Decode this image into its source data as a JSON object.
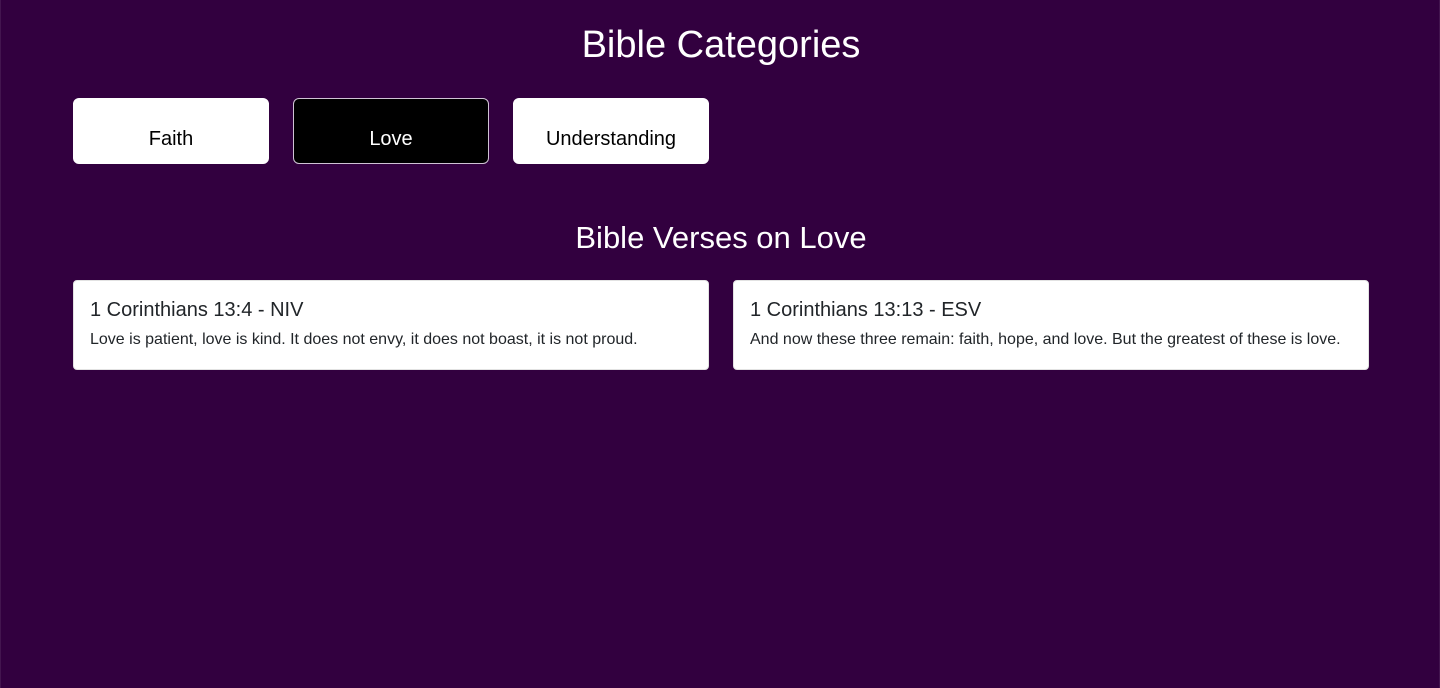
{
  "header": {
    "title": "Bible Categories"
  },
  "categories": [
    {
      "label": "Faith",
      "active": false
    },
    {
      "label": "Love",
      "active": true
    },
    {
      "label": "Understanding",
      "active": false
    }
  ],
  "section": {
    "title": "Bible Verses on Love"
  },
  "verses": [
    {
      "reference": "1 Corinthians 13:4 - NIV",
      "text": "Love is patient, love is kind. It does not envy, it does not boast, it is not proud."
    },
    {
      "reference": "1 Corinthians 13:13 - ESV",
      "text": "And now these three remain: faith, hope, and love. But the greatest of these is love."
    }
  ],
  "colors": {
    "background": "#32003f",
    "card": "#ffffff",
    "active_button": "#000000"
  }
}
